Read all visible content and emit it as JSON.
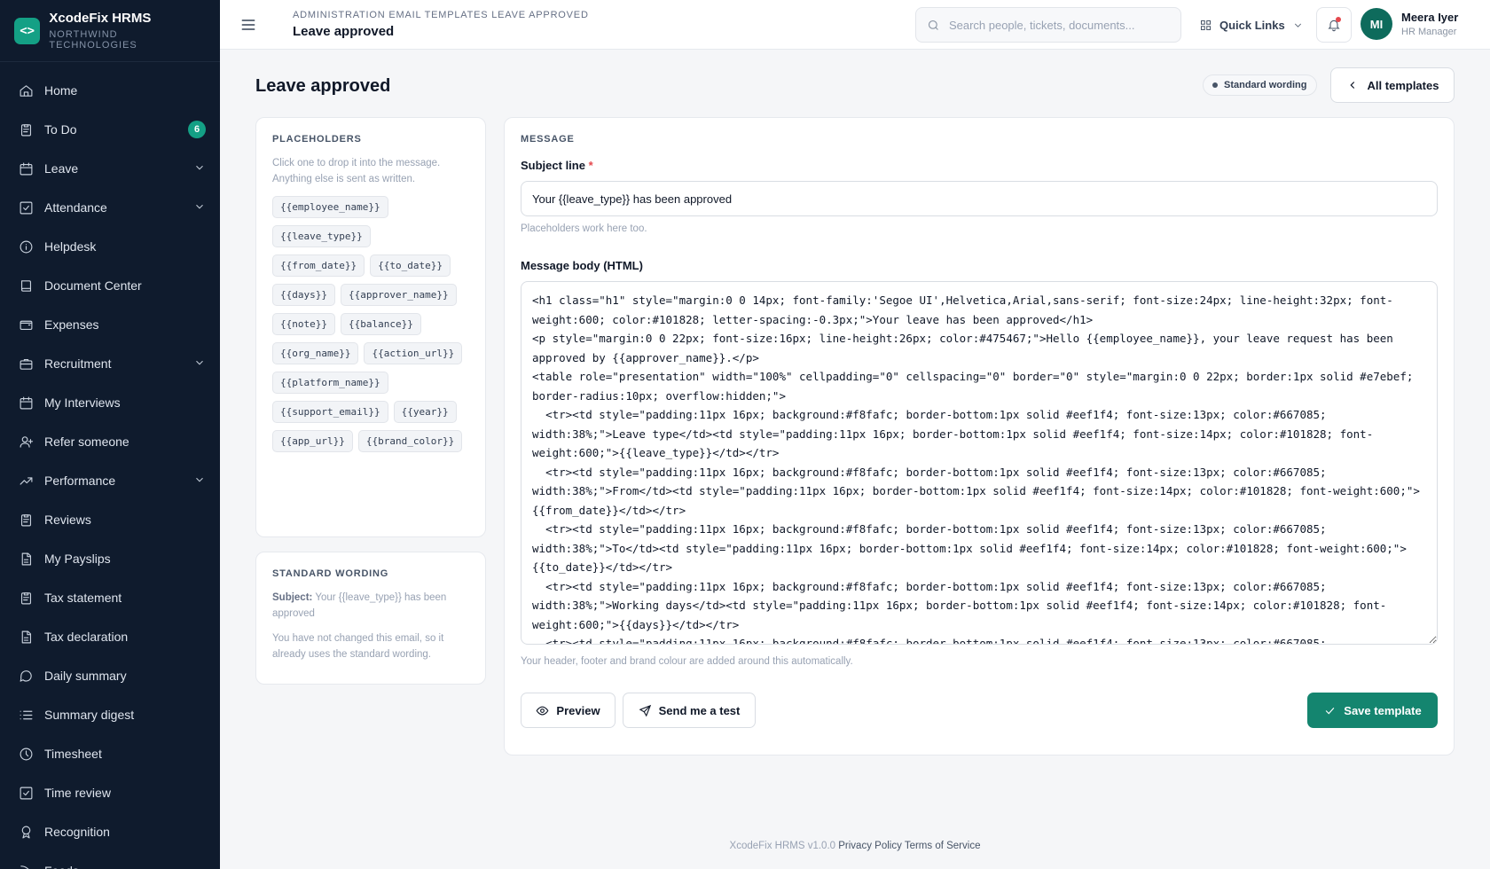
{
  "app": {
    "name": "XcodeFix HRMS",
    "org": "NORTHWIND TECHNOLOGIES"
  },
  "sidebar": {
    "items": [
      {
        "label": "Home",
        "icon": "home-icon"
      },
      {
        "label": "To Do",
        "icon": "clipboard-icon",
        "badge": "6"
      },
      {
        "label": "Leave",
        "icon": "calendar-icon",
        "chevron": true
      },
      {
        "label": "Attendance",
        "icon": "check-square-icon",
        "chevron": true
      },
      {
        "label": "Helpdesk",
        "icon": "info-icon"
      },
      {
        "label": "Document Center",
        "icon": "book-icon"
      },
      {
        "label": "Expenses",
        "icon": "wallet-icon"
      },
      {
        "label": "Recruitment",
        "icon": "briefcase-icon",
        "chevron": true
      },
      {
        "label": "My Interviews",
        "icon": "calendar-icon"
      },
      {
        "label": "Refer someone",
        "icon": "user-plus-icon"
      },
      {
        "label": "Performance",
        "icon": "trending-up-icon",
        "chevron": true
      },
      {
        "label": "Reviews",
        "icon": "clipboard-icon"
      },
      {
        "label": "My Payslips",
        "icon": "file-icon"
      },
      {
        "label": "Tax statement",
        "icon": "clipboard-icon"
      },
      {
        "label": "Tax declaration",
        "icon": "file-icon"
      },
      {
        "label": "Daily summary",
        "icon": "message-icon"
      },
      {
        "label": "Summary digest",
        "icon": "list-icon"
      },
      {
        "label": "Timesheet",
        "icon": "clock-icon"
      },
      {
        "label": "Time review",
        "icon": "check-square-icon"
      },
      {
        "label": "Recognition",
        "icon": "award-icon"
      },
      {
        "label": "Feeds",
        "icon": "rss-icon"
      }
    ]
  },
  "topbar": {
    "breadcrumb": "ADMINISTRATION EMAIL TEMPLATES LEAVE APPROVED",
    "title": "Leave approved",
    "search_placeholder": "Search people, tickets, documents...",
    "quick_links": "Quick Links",
    "user": {
      "initials": "MI",
      "name": "Meera Iyer",
      "role": "HR Manager"
    }
  },
  "page": {
    "title": "Leave approved",
    "status_pill": "Standard wording",
    "all_templates": "All templates"
  },
  "placeholders": {
    "heading": "PLACEHOLDERS",
    "help": "Click one to drop it into the message. Anything else is sent as written.",
    "chips": [
      "{{employee_name}}",
      "{{leave_type}}",
      "{{from_date}}",
      "{{to_date}}",
      "{{days}}",
      "{{approver_name}}",
      "{{note}}",
      "{{balance}}",
      "{{org_name}}",
      "{{action_url}}",
      "{{platform_name}}",
      "{{support_email}}",
      "{{year}}",
      "{{app_url}}",
      "{{brand_color}}"
    ]
  },
  "standard_wording": {
    "heading": "STANDARD WORDING",
    "subject_label": "Subject:",
    "subject_value": "Your {{leave_type}} has been approved",
    "note": "You have not changed this email, so it already uses the standard wording."
  },
  "message": {
    "heading": "MESSAGE",
    "subject_label": "Subject line",
    "required_mark": "*",
    "subject_value": "Your {{leave_type}} has been approved",
    "subject_hint": "Placeholders work here too.",
    "body_label": "Message body (HTML)",
    "body_value": "<h1 class=\"h1\" style=\"margin:0 0 14px; font-family:'Segoe UI',Helvetica,Arial,sans-serif; font-size:24px; line-height:32px; font-weight:600; color:#101828; letter-spacing:-0.3px;\">Your leave has been approved</h1>\n<p style=\"margin:0 0 22px; font-size:16px; line-height:26px; color:#475467;\">Hello {{employee_name}}, your leave request has been approved by {{approver_name}}.</p>\n<table role=\"presentation\" width=\"100%\" cellpadding=\"0\" cellspacing=\"0\" border=\"0\" style=\"margin:0 0 22px; border:1px solid #e7ebef; border-radius:10px; overflow:hidden;\">\n  <tr><td style=\"padding:11px 16px; background:#f8fafc; border-bottom:1px solid #eef1f4; font-size:13px; color:#667085; width:38%;\">Leave type</td><td style=\"padding:11px 16px; border-bottom:1px solid #eef1f4; font-size:14px; color:#101828; font-weight:600;\">{{leave_type}}</td></tr>\n  <tr><td style=\"padding:11px 16px; background:#f8fafc; border-bottom:1px solid #eef1f4; font-size:13px; color:#667085; width:38%;\">From</td><td style=\"padding:11px 16px; border-bottom:1px solid #eef1f4; font-size:14px; color:#101828; font-weight:600;\">{{from_date}}</td></tr>\n  <tr><td style=\"padding:11px 16px; background:#f8fafc; border-bottom:1px solid #eef1f4; font-size:13px; color:#667085; width:38%;\">To</td><td style=\"padding:11px 16px; border-bottom:1px solid #eef1f4; font-size:14px; color:#101828; font-weight:600;\">{{to_date}}</td></tr>\n  <tr><td style=\"padding:11px 16px; background:#f8fafc; border-bottom:1px solid #eef1f4; font-size:13px; color:#667085; width:38%;\">Working days</td><td style=\"padding:11px 16px; border-bottom:1px solid #eef1f4; font-size:14px; color:#101828; font-weight:600;\">{{days}}</td></tr>\n  <tr><td style=\"padding:11px 16px; background:#f8fafc; border-bottom:1px solid #eef1f4; font-size:13px; color:#667085;",
    "body_hint": "Your header, footer and brand colour are added around this automatically.",
    "preview_label": "Preview",
    "test_label": "Send me a test",
    "save_label": "Save template"
  },
  "footer": {
    "version": "XcodeFix HRMS v1.0.0",
    "privacy": "Privacy Policy",
    "terms": "Terms of Service"
  },
  "colors": {
    "sidebar_bg": "#0f1b2d",
    "accent": "#14856f",
    "badge": "#14a085"
  }
}
